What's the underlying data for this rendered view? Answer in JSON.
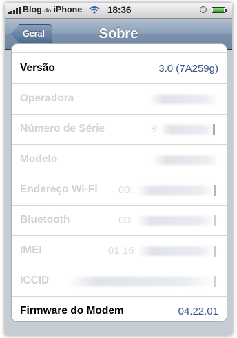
{
  "status_bar": {
    "carrier": "Blog",
    "carrier_small": "do",
    "carrier_tail": "iPhone",
    "time": "18:36",
    "icons": [
      "signal-icon",
      "wifi-icon",
      "alarm-icon",
      "battery-icon"
    ]
  },
  "nav": {
    "back_label": "Geral",
    "title": "Sobre"
  },
  "rows": [
    {
      "label": "Versão",
      "value": "3.0 (7A259g)"
    },
    {
      "label": "Operadora",
      "value": ""
    },
    {
      "label": "Número de Série",
      "value": "8!"
    },
    {
      "label": "Modelo",
      "value": ""
    },
    {
      "label": "Endereço Wi-Fi",
      "value": "00:"
    },
    {
      "label": "Bluetooth",
      "value": "00:"
    },
    {
      "label": "IMEI",
      "value": "01 16"
    },
    {
      "label": "ICCID",
      "value": ""
    },
    {
      "label": "Firmware do Modem",
      "value": "04.22.01"
    }
  ],
  "colors": {
    "nav_bar": "#6d86a3",
    "value_text": "#385487",
    "background": "#c5ccd4"
  }
}
